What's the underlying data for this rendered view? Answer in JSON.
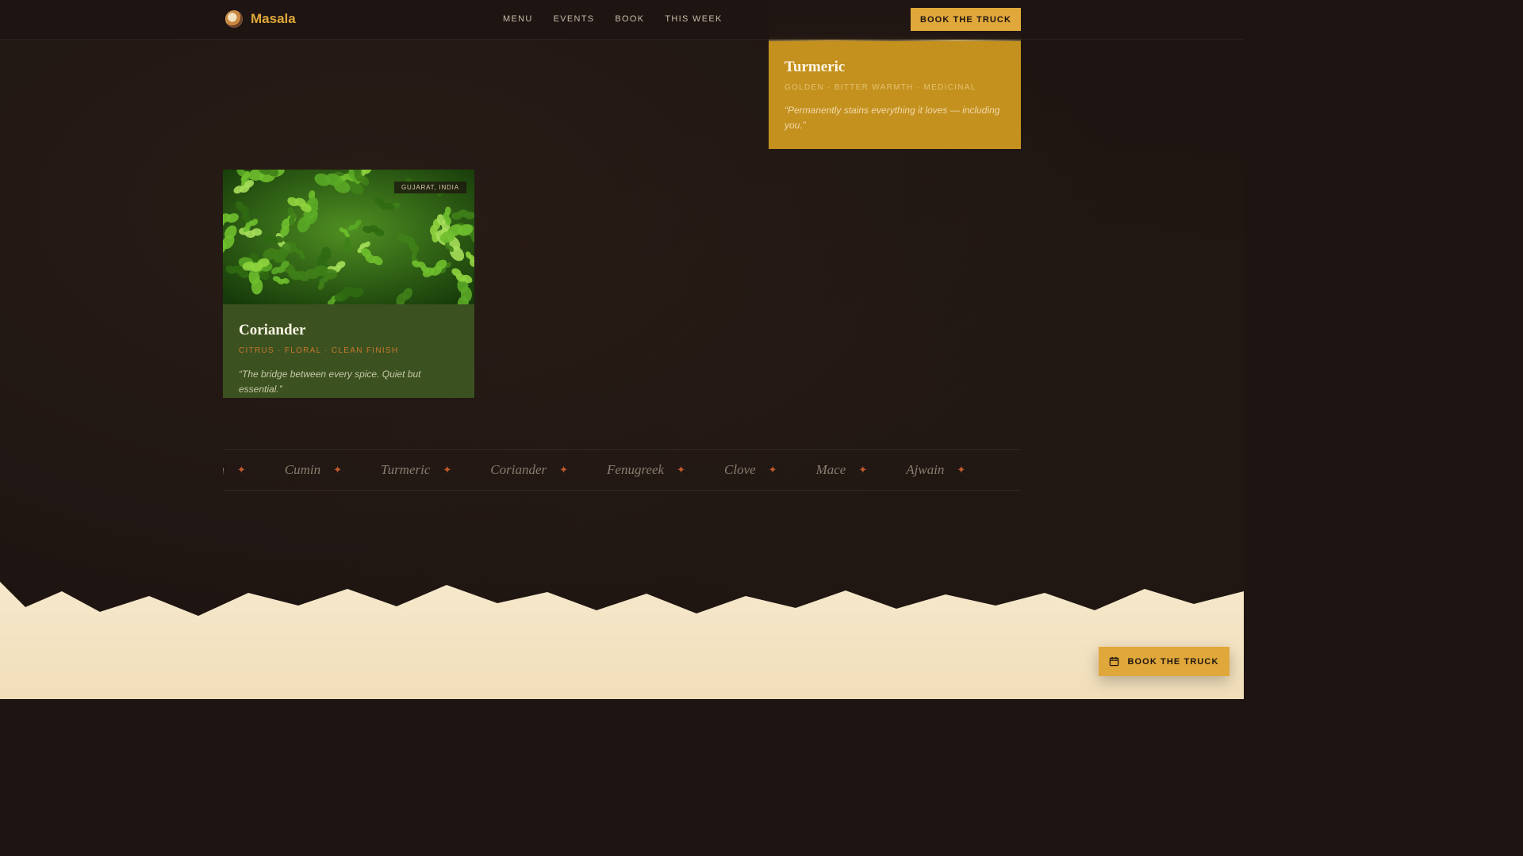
{
  "brand": {
    "name": "Masala",
    "logo_icon": "spice-bowl-icon"
  },
  "nav": {
    "items": [
      {
        "label": "MENU"
      },
      {
        "label": "EVENTS"
      },
      {
        "label": "BOOK"
      },
      {
        "label": "THIS WEEK"
      }
    ],
    "cta_label": "BOOK THE TRUCK"
  },
  "cards": {
    "turmeric": {
      "name": "Turmeric",
      "tags": "GOLDEN · BITTER WARMTH · MEDICINAL",
      "quote": "“Permanently stains everything it loves — including you.”"
    },
    "coriander": {
      "name": "Coriander",
      "origin": "GUJARAT, INDIA",
      "tags": "CITRUS · FLORAL · CLEAN FINISH",
      "quote": "“The bridge between every spice. Quiet but essential.”"
    }
  },
  "marquee": {
    "items": [
      "Cardamom",
      "Cumin",
      "Turmeric",
      "Coriander",
      "Fenugreek",
      "Clove",
      "Mace",
      "Ajwain"
    ],
    "separator": "✦"
  },
  "floating_cta": {
    "label": "BOOK THE TRUCK",
    "icon": "calendar-icon"
  },
  "colors": {
    "background": "#1e1512",
    "accent": "#e0a83a",
    "turmeric_card": "#c4911f",
    "coriander_card": "#3b5220",
    "cream": "#f3e4c4",
    "marquee_star": "#c05a2e"
  }
}
